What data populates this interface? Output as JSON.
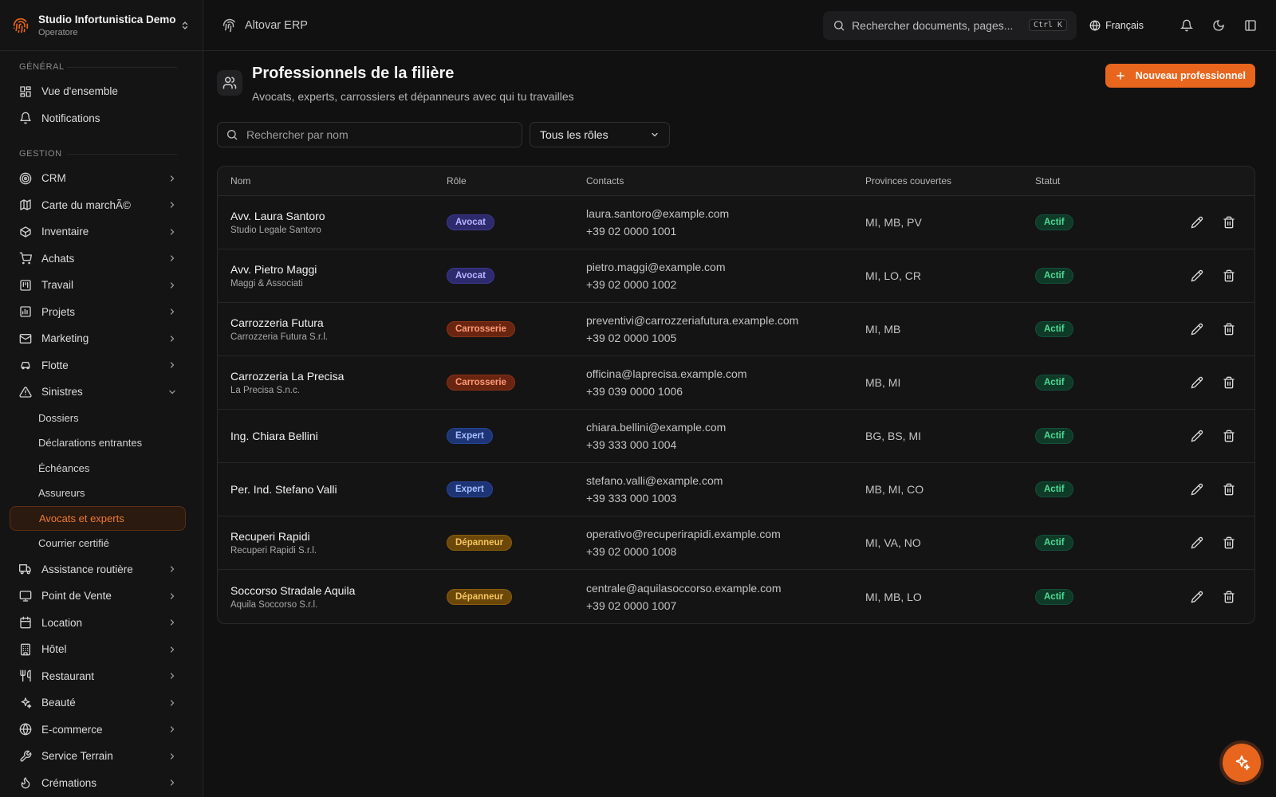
{
  "colors": {
    "accent": "#e8651d",
    "background": "#111112",
    "sidebar": "#141415"
  },
  "org": {
    "name": "Studio Infortunistica Demo",
    "role": "Operatore"
  },
  "topbar": {
    "brand": "Altovar ERP",
    "search_placeholder": "Rechercher documents, pages...",
    "shortcut": "Ctrl K",
    "language": "Français"
  },
  "sidebar": {
    "general_label": "GÉNÉRAL",
    "general": [
      {
        "label": "Vue d'ensemble",
        "icon": "dashboard-icon"
      },
      {
        "label": "Notifications",
        "icon": "bell-icon"
      }
    ],
    "gestion_label": "GESTION",
    "gestion": [
      {
        "label": "CRM",
        "icon": "target-icon"
      },
      {
        "label": "Carte du marchÃ©",
        "icon": "map-icon"
      },
      {
        "label": "Inventaire",
        "icon": "box-icon"
      },
      {
        "label": "Achats",
        "icon": "cart-icon"
      },
      {
        "label": "Travail",
        "icon": "board-icon"
      },
      {
        "label": "Projets",
        "icon": "chart-icon"
      },
      {
        "label": "Marketing",
        "icon": "mail-icon"
      },
      {
        "label": "Flotte",
        "icon": "car-icon"
      },
      {
        "label": "Sinistres",
        "icon": "warning-icon"
      }
    ],
    "sinistres_sub": [
      {
        "label": "Dossiers"
      },
      {
        "label": "Déclarations entrantes"
      },
      {
        "label": "Échéances"
      },
      {
        "label": "Assureurs"
      },
      {
        "label": "Avocats et experts",
        "active": true
      },
      {
        "label": "Courrier certifié"
      }
    ],
    "after": [
      {
        "label": "Assistance routière",
        "icon": "truck-icon"
      },
      {
        "label": "Point de Vente",
        "icon": "monitor-icon"
      },
      {
        "label": "Location",
        "icon": "calendar-icon"
      },
      {
        "label": "Hôtel",
        "icon": "building-icon"
      },
      {
        "label": "Restaurant",
        "icon": "utensils-icon"
      },
      {
        "label": "Beauté",
        "icon": "sparkles-icon"
      },
      {
        "label": "E-commerce",
        "icon": "globe-icon"
      },
      {
        "label": "Service Terrain",
        "icon": "wrench-icon"
      },
      {
        "label": "Crémations",
        "icon": "flame-icon"
      }
    ]
  },
  "page": {
    "title": "Professionnels de la filière",
    "subtitle": "Avocats, experts, carrossiers et dépanneurs avec qui tu travailles",
    "new_button": "Nouveau professionnel",
    "search_placeholder": "Rechercher par nom",
    "role_filter": "Tous les rôles"
  },
  "table": {
    "headers": [
      "Nom",
      "Rôle",
      "Contacts",
      "Provinces couvertes",
      "Statut"
    ],
    "rows": [
      {
        "name": "Avv. Laura Santoro",
        "company": "Studio Legale Santoro",
        "role": "Avocat",
        "role_kind": "avocat",
        "email": "laura.santoro@example.com",
        "phone": "+39 02 0000 1001",
        "provinces": "MI, MB, PV",
        "status": "Actif"
      },
      {
        "name": "Avv. Pietro Maggi",
        "company": "Maggi & Associati",
        "role": "Avocat",
        "role_kind": "avocat",
        "email": "pietro.maggi@example.com",
        "phone": "+39 02 0000 1002",
        "provinces": "MI, LO, CR",
        "status": "Actif"
      },
      {
        "name": "Carrozzeria Futura",
        "company": "Carrozzeria Futura S.r.l.",
        "role": "Carrosserie",
        "role_kind": "carro",
        "email": "preventivi@carrozzeriafutura.example.com",
        "phone": "+39 02 0000 1005",
        "provinces": "MI, MB",
        "status": "Actif"
      },
      {
        "name": "Carrozzeria La Precisa",
        "company": "La Precisa S.n.c.",
        "role": "Carrosserie",
        "role_kind": "carro",
        "email": "officina@laprecisa.example.com",
        "phone": "+39 039 0000 1006",
        "provinces": "MB, MI",
        "status": "Actif"
      },
      {
        "name": "Ing. Chiara Bellini",
        "company": "",
        "role": "Expert",
        "role_kind": "expert",
        "email": "chiara.bellini@example.com",
        "phone": "+39 333 000 1004",
        "provinces": "BG, BS, MI",
        "status": "Actif"
      },
      {
        "name": "Per. Ind. Stefano Valli",
        "company": "",
        "role": "Expert",
        "role_kind": "expert",
        "email": "stefano.valli@example.com",
        "phone": "+39 333 000 1003",
        "provinces": "MB, MI, CO",
        "status": "Actif"
      },
      {
        "name": "Recuperi Rapidi",
        "company": "Recuperi Rapidi S.r.l.",
        "role": "Dépanneur",
        "role_kind": "depan",
        "email": "operativo@recuperirapidi.example.com",
        "phone": "+39 02 0000 1008",
        "provinces": "MI, VA, NO",
        "status": "Actif"
      },
      {
        "name": "Soccorso Stradale Aquila",
        "company": "Aquila Soccorso S.r.l.",
        "role": "Dépanneur",
        "role_kind": "depan",
        "email": "centrale@aquilasoccorso.example.com",
        "phone": "+39 02 0000 1007",
        "provinces": "MI, MB, LO",
        "status": "Actif"
      }
    ]
  }
}
